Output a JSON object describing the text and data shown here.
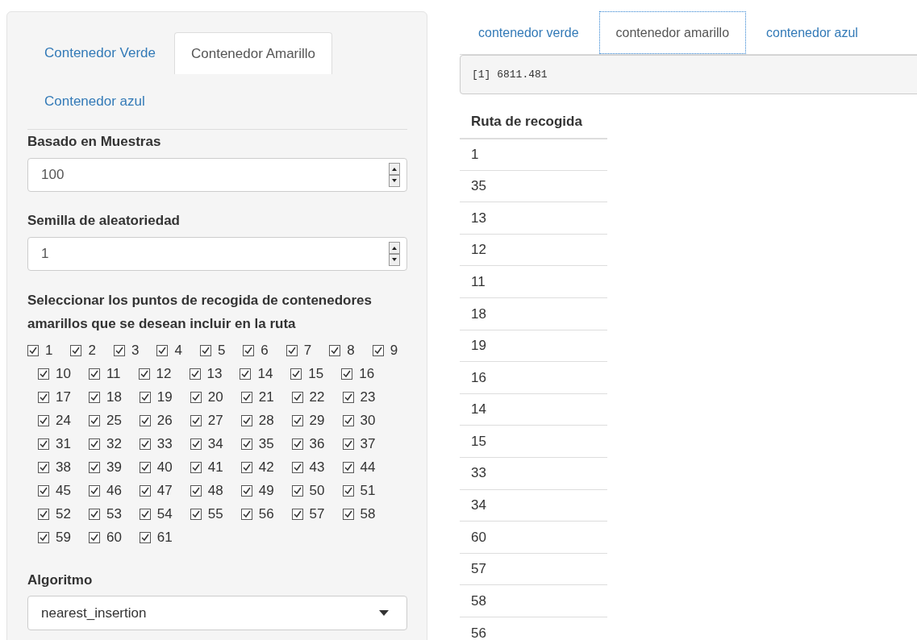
{
  "left_panel": {
    "tabs": [
      {
        "label": "Contenedor Verde",
        "selected": false
      },
      {
        "label": "Contenedor Amarillo",
        "selected": true
      },
      {
        "label": "Contenedor azul",
        "selected": false
      }
    ],
    "fields": [
      {
        "label": "Basado en Muestras",
        "value": "100"
      },
      {
        "label": "Semilla de aleatoriedad",
        "value": "1"
      }
    ],
    "checkbox_group": {
      "label": "Seleccionar los puntos de recogida de contenedores amarillos que se desean incluir en la ruta",
      "options": [
        {
          "label": "1",
          "checked": true
        },
        {
          "label": "2",
          "checked": true
        },
        {
          "label": "3",
          "checked": true
        },
        {
          "label": "4",
          "checked": true
        },
        {
          "label": "5",
          "checked": true
        },
        {
          "label": "6",
          "checked": true
        },
        {
          "label": "7",
          "checked": true
        },
        {
          "label": "8",
          "checked": true
        },
        {
          "label": "9",
          "checked": true
        },
        {
          "label": "10",
          "checked": true
        },
        {
          "label": "11",
          "checked": true
        },
        {
          "label": "12",
          "checked": true
        },
        {
          "label": "13",
          "checked": true
        },
        {
          "label": "14",
          "checked": true
        },
        {
          "label": "15",
          "checked": true
        },
        {
          "label": "16",
          "checked": true
        },
        {
          "label": "17",
          "checked": true
        },
        {
          "label": "18",
          "checked": true
        },
        {
          "label": "19",
          "checked": true
        },
        {
          "label": "20",
          "checked": true
        },
        {
          "label": "21",
          "checked": true
        },
        {
          "label": "22",
          "checked": true
        },
        {
          "label": "23",
          "checked": true
        },
        {
          "label": "24",
          "checked": true
        },
        {
          "label": "25",
          "checked": true
        },
        {
          "label": "26",
          "checked": true
        },
        {
          "label": "27",
          "checked": true
        },
        {
          "label": "28",
          "checked": true
        },
        {
          "label": "29",
          "checked": true
        },
        {
          "label": "30",
          "checked": true
        },
        {
          "label": "31",
          "checked": true
        },
        {
          "label": "32",
          "checked": true
        },
        {
          "label": "33",
          "checked": true
        },
        {
          "label": "34",
          "checked": true
        },
        {
          "label": "35",
          "checked": true
        },
        {
          "label": "36",
          "checked": true
        },
        {
          "label": "37",
          "checked": true
        },
        {
          "label": "38",
          "checked": true
        },
        {
          "label": "39",
          "checked": true
        },
        {
          "label": "40",
          "checked": true
        },
        {
          "label": "41",
          "checked": true
        },
        {
          "label": "42",
          "checked": true
        },
        {
          "label": "43",
          "checked": true
        },
        {
          "label": "44",
          "checked": true
        },
        {
          "label": "45",
          "checked": true
        },
        {
          "label": "46",
          "checked": true
        },
        {
          "label": "47",
          "checked": true
        },
        {
          "label": "48",
          "checked": true
        },
        {
          "label": "49",
          "checked": true
        },
        {
          "label": "50",
          "checked": true
        },
        {
          "label": "51",
          "checked": true
        },
        {
          "label": "52",
          "checked": true
        },
        {
          "label": "53",
          "checked": true
        },
        {
          "label": "54",
          "checked": true
        },
        {
          "label": "55",
          "checked": true
        },
        {
          "label": "56",
          "checked": true
        },
        {
          "label": "57",
          "checked": true
        },
        {
          "label": "58",
          "checked": true
        },
        {
          "label": "59",
          "checked": true
        },
        {
          "label": "60",
          "checked": true
        },
        {
          "label": "61",
          "checked": true
        }
      ]
    },
    "select": {
      "label": "Algoritmo",
      "value": "nearest_insertion"
    }
  },
  "right_panel": {
    "tabs": [
      {
        "label": "contenedor verde",
        "selected": false
      },
      {
        "label": "contenedor amarillo",
        "selected": true
      },
      {
        "label": "contenedor azul",
        "selected": false
      }
    ],
    "output": "[1] 6811.481",
    "table": {
      "columns": [
        "Ruta de recogida"
      ],
      "rows": [
        [
          "1"
        ],
        [
          "35"
        ],
        [
          "13"
        ],
        [
          "12"
        ],
        [
          "11"
        ],
        [
          "18"
        ],
        [
          "19"
        ],
        [
          "16"
        ],
        [
          "14"
        ],
        [
          "15"
        ],
        [
          "33"
        ],
        [
          "34"
        ],
        [
          "60"
        ],
        [
          "57"
        ],
        [
          "58"
        ],
        [
          "56"
        ]
      ]
    }
  }
}
